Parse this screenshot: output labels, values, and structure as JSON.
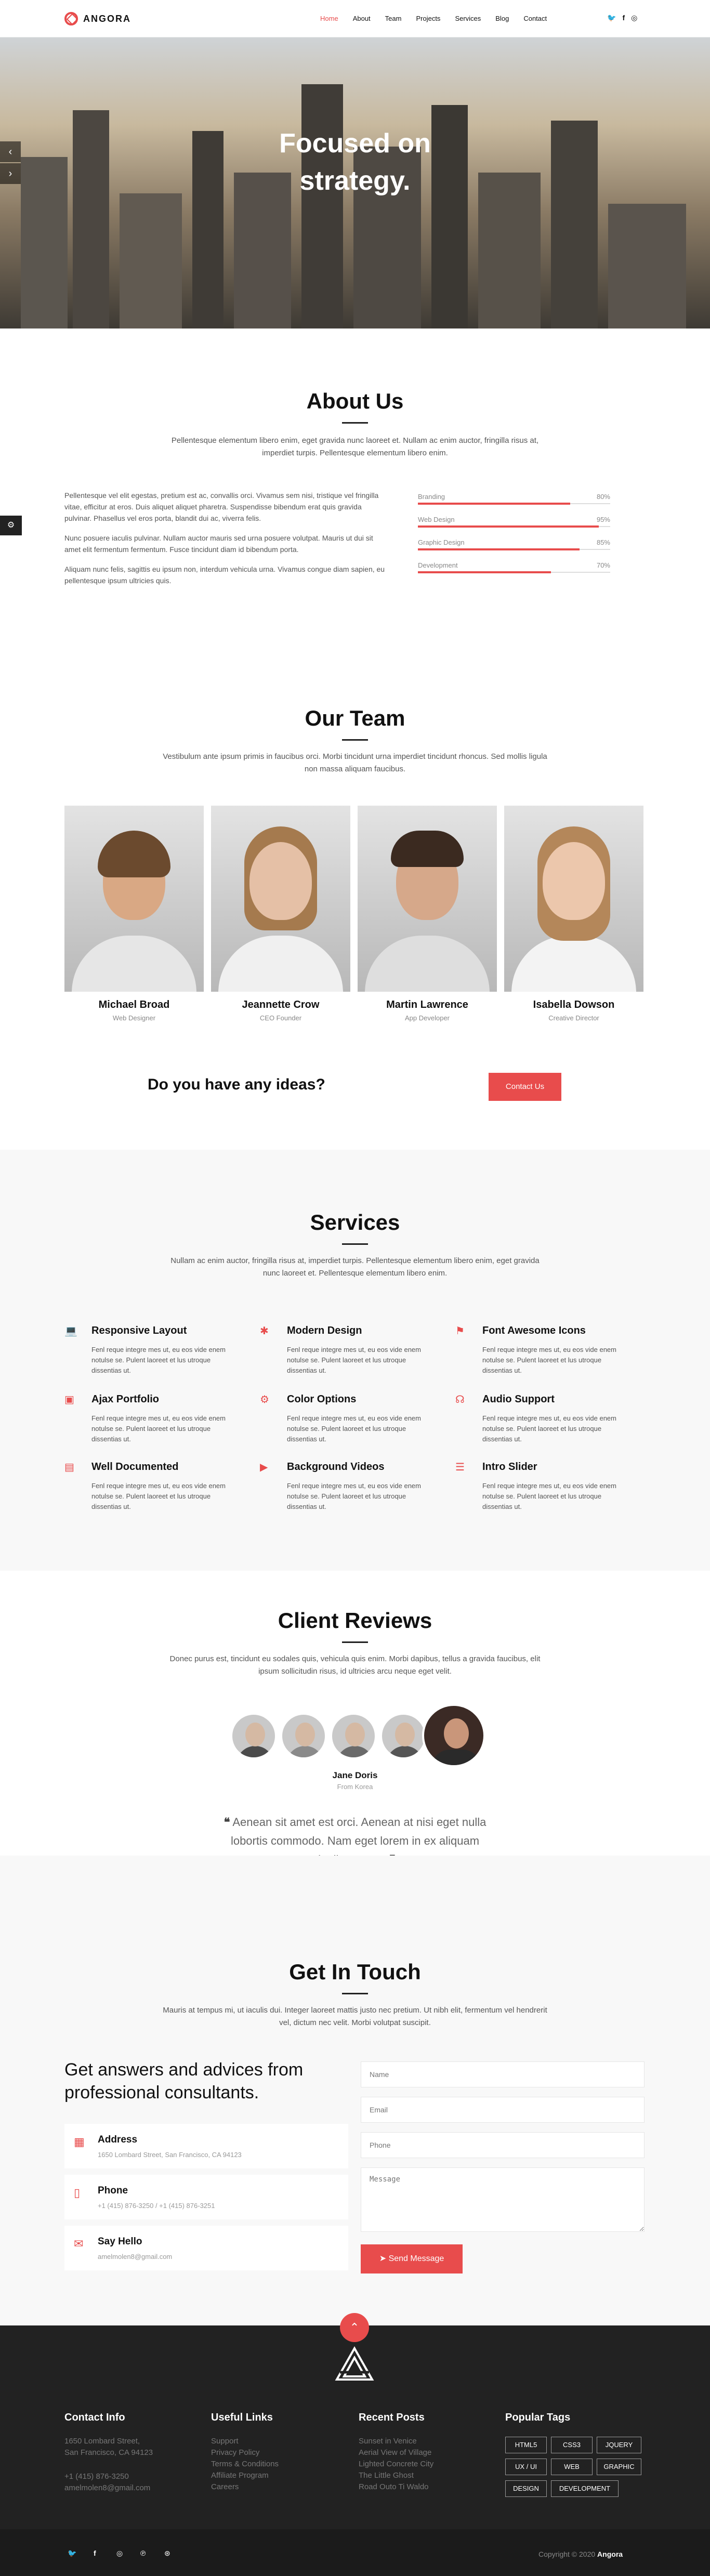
{
  "header": {
    "brand": "ANGORA",
    "nav": [
      "Home",
      "About",
      "Team",
      "Projects",
      "Services",
      "Blog",
      "Contact"
    ],
    "social_icons": [
      "twitter-icon",
      "facebook-icon",
      "instagram-icon"
    ]
  },
  "hero": {
    "title_line1": "Focused on",
    "title_line2": "strategy."
  },
  "about": {
    "title": "About Us",
    "subtitle": "Pellentesque elementum libero enim, eget gravida nunc laoreet et. Nullam ac enim auctor, fringilla risus at, imperdiet turpis. Pellentesque elementum libero enim.",
    "para1": "Pellentesque vel elit egestas, pretium est ac, convallis orci. Vivamus sem nisi, tristique vel fringilla vitae, efficitur at eros. Duis aliquet aliquet pharetra. Suspendisse bibendum erat quis gravida pulvinar. Phasellus vel eros porta, blandit dui ac, viverra felis.",
    "para2": "Nunc posuere iaculis pulvinar. Nullam auctor mauris sed urna posuere volutpat. Mauris ut dui sit amet elit fermentum fermentum. Fusce tincidunt diam id bibendum porta.",
    "para3": "Aliquam nunc felis, sagittis eu ipsum non, interdum vehicula urna. Vivamus congue diam sapien, eu pellentesque ipsum ultricies quis.",
    "skills": [
      {
        "name": "Branding",
        "percent": 80,
        "label": "80%"
      },
      {
        "name": "Web Design",
        "percent": 95,
        "label": "95%"
      },
      {
        "name": "Graphic Design",
        "percent": 85,
        "label": "85%"
      },
      {
        "name": "Development",
        "percent": 70,
        "label": "70%"
      }
    ]
  },
  "team": {
    "title": "Our Team",
    "subtitle": "Vestibulum ante ipsum primis in faucibus orci. Morbi tincidunt urna imperdiet tincidunt rhoncus. Sed mollis ligula non massa aliquam faucibus.",
    "members": [
      {
        "name": "Michael Broad",
        "role": "Web Designer"
      },
      {
        "name": "Jeannette Crow",
        "role": "CEO Founder"
      },
      {
        "name": "Martin Lawrence",
        "role": "App Developer"
      },
      {
        "name": "Isabella Dowson",
        "role": "Creative Director"
      }
    ]
  },
  "cta": {
    "text": "Do you have any ideas?",
    "button": "Contact Us"
  },
  "services": {
    "title": "Services",
    "subtitle": "Nullam ac enim auctor, fringilla risus at, imperdiet turpis. Pellentesque elementum libero enim, eget gravida nunc laoreet et. Pellentesque elementum libero enim.",
    "items": [
      {
        "title": "Responsive Layout",
        "icon": "laptop-icon",
        "text": "Fenl reque integre mes ut, eu eos vide enem notulse se. Pulent laoreet et lus utroque dissentias ut."
      },
      {
        "title": "Modern Design",
        "icon": "magic-icon",
        "text": "Fenl reque integre mes ut, eu eos vide enem notulse se. Pulent laoreet et lus utroque dissentias ut."
      },
      {
        "title": "Font Awesome Icons",
        "icon": "flag-icon",
        "text": "Fenl reque integre mes ut, eu eos vide enem notulse se. Pulent laoreet et lus utroque dissentias ut."
      },
      {
        "title": "Ajax Portfolio",
        "icon": "id-card-icon",
        "text": "Fenl reque integre mes ut, eu eos vide enem notulse se. Pulent laoreet et lus utroque dissentias ut."
      },
      {
        "title": "Color Options",
        "icon": "gear-icon",
        "text": "Fenl reque integre mes ut, eu eos vide enem notulse se. Pulent laoreet et lus utroque dissentias ut."
      },
      {
        "title": "Audio Support",
        "icon": "headphones-icon",
        "text": "Fenl reque integre mes ut, eu eos vide enem notulse se. Pulent laoreet et lus utroque dissentias ut."
      },
      {
        "title": "Well Documented",
        "icon": "clipboard-icon",
        "text": "Fenl reque integre mes ut, eu eos vide enem notulse se. Pulent laoreet et lus utroque dissentias ut."
      },
      {
        "title": "Background Videos",
        "icon": "video-icon",
        "text": "Fenl reque integre mes ut, eu eos vide enem notulse se. Pulent laoreet et lus utroque dissentias ut."
      },
      {
        "title": "Intro Slider",
        "icon": "sliders-icon",
        "text": "Fenl reque integre mes ut, eu eos vide enem notulse se. Pulent laoreet et lus utroque dissentias ut."
      }
    ]
  },
  "reviews": {
    "title": "Client Reviews",
    "subtitle": "Donec purus est, tincidunt eu sodales quis, vehicula quis enim. Morbi dapibus, tellus a gravida faucibus, elit ipsum sollicitudin risus, id ultricies arcu neque eget velit.",
    "active_name": "Jane Doris",
    "active_role": "From Korea",
    "quote": "Aenean sit amet est orci. Aenean at nisi eget nulla lobortis commodo. Nam eget lorem in ex aliquam dapibus. cere."
  },
  "contact": {
    "title": "Get In Touch",
    "subtitle": "Mauris at tempus mi, ut iaculis dui. Integer laoreet mattis justo nec pretium. Ut nibh elit, fermentum vel hendrerit vel, dictum nec velit. Morbi volutpat suscipit.",
    "headline": "Get answers and advices from professional consultants.",
    "info": [
      {
        "title": "Address",
        "icon": "map-icon",
        "text": "1650 Lombard Street, San Francisco, CA 94123"
      },
      {
        "title": "Phone",
        "icon": "phone-icon",
        "text": "+1 (415) 876-3250 / +1 (415) 876-3251"
      },
      {
        "title": "Say Hello",
        "icon": "envelope-icon",
        "text": "amelmolen8@gmail.com"
      }
    ],
    "placeholders": {
      "name": "Name",
      "email": "Email",
      "phone": "Phone",
      "message": "Message"
    },
    "send_button": "Send Message"
  },
  "footer": {
    "contact_title": "Contact Info",
    "contact_lines": [
      "1650 Lombard Street,",
      "San Francisco, CA 94123",
      "",
      "+1 (415) 876-3250",
      "amelmolen8@gmail.com"
    ],
    "links_title": "Useful Links",
    "links": [
      "Support",
      "Privacy Policy",
      "Terms & Conditions",
      "Affiliate Program",
      "Careers"
    ],
    "posts_title": "Recent Posts",
    "posts": [
      "Sunset in Venice",
      "Aerial View of Village",
      "Lighted Concrete City",
      "The Little Ghost",
      "Road Outo Ti Waldo"
    ],
    "tags_title": "Popular Tags",
    "tags": [
      "HTML5",
      "CSS3",
      "JQUERY",
      "UX / UI",
      "WEB",
      "GRAPHIC",
      "DESIGN",
      "DEVELOPMENT"
    ],
    "copyright_prefix": "Copyright © 2020",
    "copyright_brand": "Angora",
    "social_icons": [
      "twitter-icon",
      "facebook-icon",
      "instagram-icon",
      "pinterest-icon",
      "dribbble-icon"
    ]
  },
  "colors": {
    "accent": "#e84c4c",
    "dark": "#222222"
  }
}
